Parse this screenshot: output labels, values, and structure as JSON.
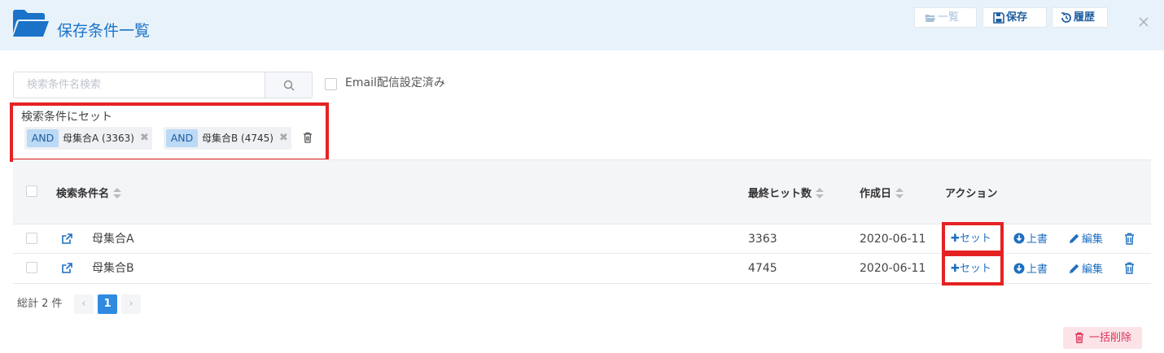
{
  "header": {
    "title": "保存条件一覧",
    "buttons": {
      "list": "一覧",
      "save": "保存",
      "history": "履歴"
    }
  },
  "search": {
    "placeholder": "検索条件名検索"
  },
  "email_filter": {
    "label": "Email配信設定済み",
    "checked": false
  },
  "set_panel": {
    "label": "検索条件にセット",
    "tags": [
      {
        "op": "AND",
        "text": "母集合A (3363)"
      },
      {
        "op": "AND",
        "text": "母集合B (4745)"
      }
    ]
  },
  "table": {
    "columns": {
      "name": "検索条件名",
      "hits": "最終ヒット数",
      "created": "作成日",
      "action": "アクション"
    },
    "rows": [
      {
        "name": "母集合A",
        "hits": "3363",
        "created": "2020-06-11"
      },
      {
        "name": "母集合B",
        "hits": "4745",
        "created": "2020-06-11"
      }
    ],
    "actions": {
      "set": "セット",
      "overwrite": "上書",
      "edit": "編集"
    }
  },
  "pagination": {
    "total": "総計 2 件",
    "current": "1"
  },
  "bulk_delete": "一括削除",
  "colors": {
    "accent": "#1a73c8",
    "highlight": "#e52222",
    "danger": "#d9365a"
  }
}
